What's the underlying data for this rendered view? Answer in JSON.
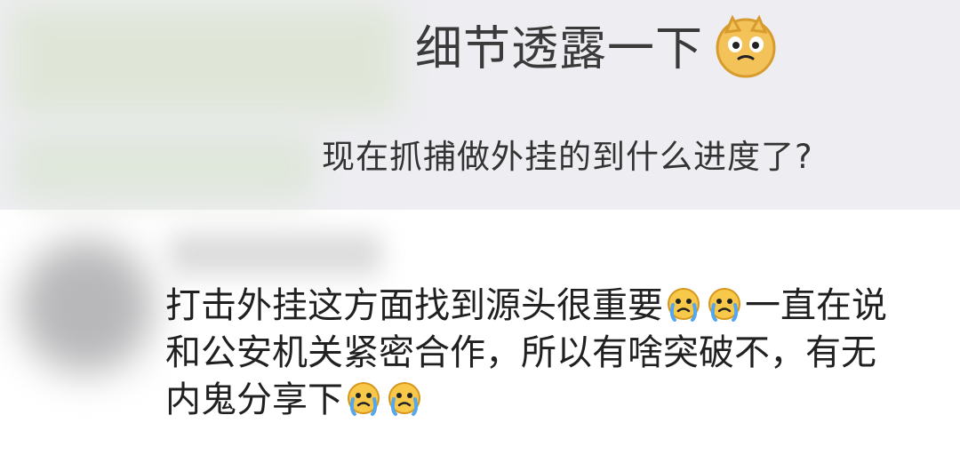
{
  "comment_thread": {
    "reply_title": "细节透露一下",
    "reply_question": "现在抓捕做外挂的到什么进度了?",
    "comment_lines": [
      "打击外挂这方面找到源头很重要",
      "一直在说",
      "和公安机关紧密合作，所以有啥突破不，有无",
      "内鬼分享下"
    ]
  },
  "icons": {
    "doge": "doge-emoji-icon",
    "cry": "crying-emoji-icon"
  },
  "colors": {
    "top_panel": "#eeeef2",
    "text": "#202020",
    "emoji_yellow": "#f7c84a"
  }
}
